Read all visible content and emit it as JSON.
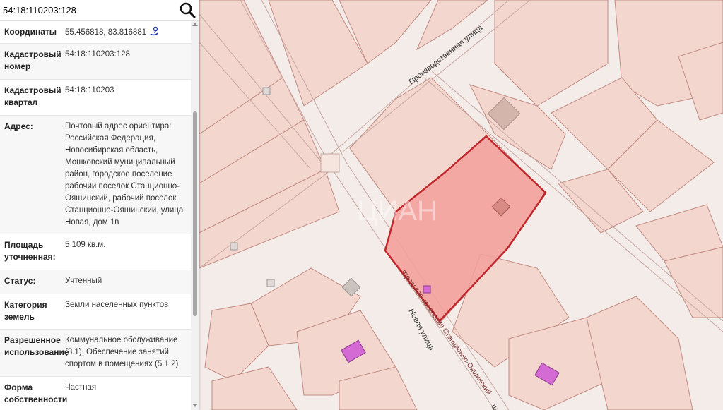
{
  "search": {
    "value": "54:18:110203:128"
  },
  "rows": [
    {
      "label": "Координаты",
      "value": "55.456818, 83.816881"
    },
    {
      "label": "Кадастровый номер",
      "value": "54:18:110203:128"
    },
    {
      "label": "Кадастровый квартал",
      "value": "54:18:110203"
    },
    {
      "label": "Адрес:",
      "value": "Почтовый адрес ориентира: Российская Федерация, Новосибирская область, Мошковский муниципальный район, городское поселение рабочий поселок Станционно-Ояшинский, рабочий поселок Станционно-Ояшинский, улица Новая, дом 1в"
    },
    {
      "label": "Площадь уточненная:",
      "value": "5 109 кв.м."
    },
    {
      "label": "Статус:",
      "value": "Учтенный"
    },
    {
      "label": "Категория земель",
      "value": "Земли населенных пунктов"
    },
    {
      "label": "Разрешенное использование",
      "value": "Коммунальное обслуживание (3.1), Обеспечение занятий спортом в помещениях (5.1.2)"
    },
    {
      "label": "Форма собственности",
      "value": "Частная"
    }
  ],
  "map": {
    "streets": {
      "proizvodstvennaya": "Производственная улица",
      "novaya": "Новая улица",
      "poselenie_label": "городское поселение Станционно-Ояшинский",
      "bottom_fragment": "ш"
    },
    "watermark": "ЦИАН"
  },
  "colors": {
    "parcel_fill": "#f4a3a0",
    "parcel_border": "#c0262a",
    "plot_fill": "#f3d5cd",
    "plot_border": "#c78a80",
    "building_purple": "#d46ad4"
  }
}
